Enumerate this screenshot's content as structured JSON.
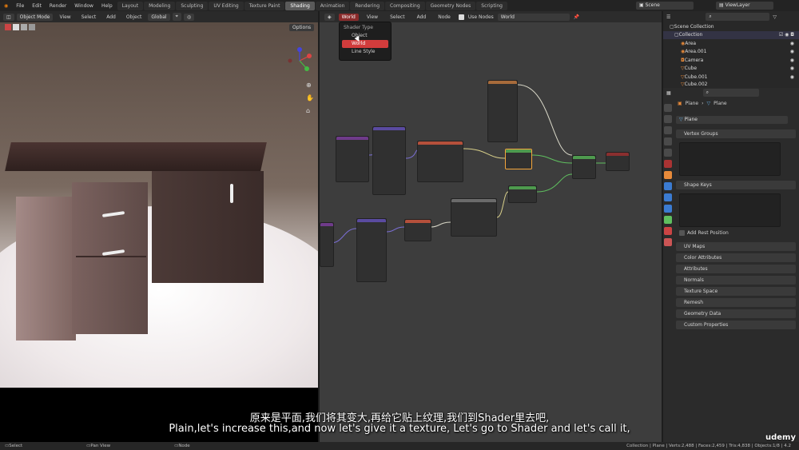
{
  "topbar": {
    "menus": [
      "File",
      "Edit",
      "Render",
      "Window",
      "Help"
    ],
    "workspaces": [
      "Layout",
      "Modeling",
      "Sculpting",
      "UV Editing",
      "Texture Paint",
      "Shading",
      "Animation",
      "Rendering",
      "Compositing",
      "Geometry Nodes",
      "Scripting"
    ],
    "active_workspace": "Shading",
    "scene": "Scene",
    "view_layer": "ViewLayer"
  },
  "viewport": {
    "mode": "Object Mode",
    "menus": [
      "View",
      "Select",
      "Add",
      "Object"
    ],
    "transform": "Global",
    "options": "Options"
  },
  "node_editor": {
    "shader_type_value": "World",
    "menus": [
      "View",
      "Select",
      "Add",
      "Node"
    ],
    "use_nodes": "Use Nodes",
    "world_field": "World",
    "popup": {
      "title": "Shader Type",
      "items": [
        "Object",
        "World",
        "Line Style"
      ],
      "selected": "World"
    }
  },
  "outliner": {
    "rows": [
      "Scene Collection",
      "Collection",
      "Area",
      "Area.001",
      "Camera",
      "Cube",
      "Cube.001",
      "Cube.002"
    ]
  },
  "properties": {
    "breadcrumb": [
      "Plane",
      "Plane"
    ],
    "name_field": "Plane",
    "panels": [
      "Vertex Groups",
      "Shape Keys",
      "UV Maps",
      "Color Attributes",
      "Attributes",
      "Normals",
      "Texture Space",
      "Remesh",
      "Geometry Data",
      "Custom Properties"
    ],
    "add_rest_position": "Add Rest Position"
  },
  "subtitles": {
    "zh": "原来是平面,我们将其变大,再给它贴上纹理,我们到Shader里去吧,",
    "en": "Plain,let's increase this,and now let's give it a texture, Let's go to Shader and let's call it,"
  },
  "statusbar": {
    "select": "Select",
    "pan": "Pan View",
    "node": "Node",
    "stats": "Collection | Plane | Verts:2,488 | Faces:2,459 | Tris:4,838 | Objects:1/8 | 4.2"
  },
  "watermark": "udemy",
  "colors": {
    "accent_red": "#d23c3c",
    "active_tab": "#5a5a5a",
    "node_bg": "#3d3d3d"
  }
}
